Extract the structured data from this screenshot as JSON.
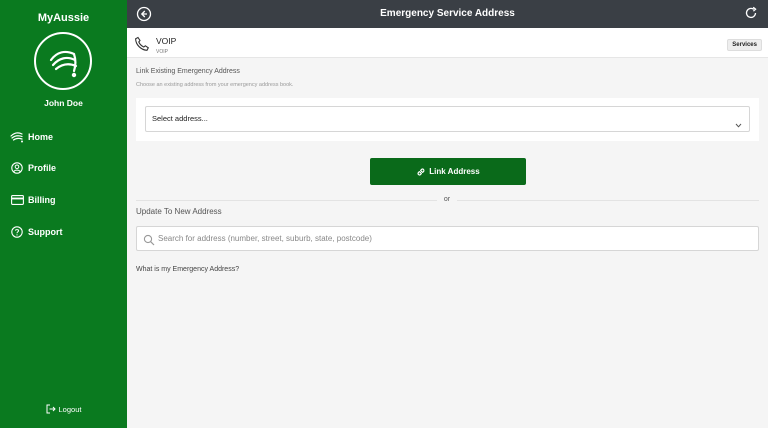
{
  "sidebar": {
    "brand": "MyAussie",
    "user_name": "John Doe",
    "items": [
      {
        "label": "Home",
        "icon": "wifi-icon"
      },
      {
        "label": "Profile",
        "icon": "user-circle-icon"
      },
      {
        "label": "Billing",
        "icon": "credit-card-icon"
      },
      {
        "label": "Support",
        "icon": "question-icon"
      }
    ],
    "logout_label": "Logout"
  },
  "header": {
    "title": "Emergency Service Address"
  },
  "service": {
    "name": "VOIP",
    "sub": "VOIP",
    "badge": "Services"
  },
  "link_existing": {
    "title": "Link Existing Emergency Address",
    "description": "Choose an existing address from your emergency address book.",
    "select_value": "Select address...",
    "button_label": "Link Address"
  },
  "divider_text": "or",
  "update_new": {
    "title": "Update To New Address",
    "search_placeholder": "Search for address (number, street, suburb, state, postcode)"
  },
  "help_link": "What is my Emergency Address?",
  "colors": {
    "sidebar_green": "#0a7a1f",
    "button_green": "#0a6a1a",
    "header_dark": "#3a3f45"
  }
}
